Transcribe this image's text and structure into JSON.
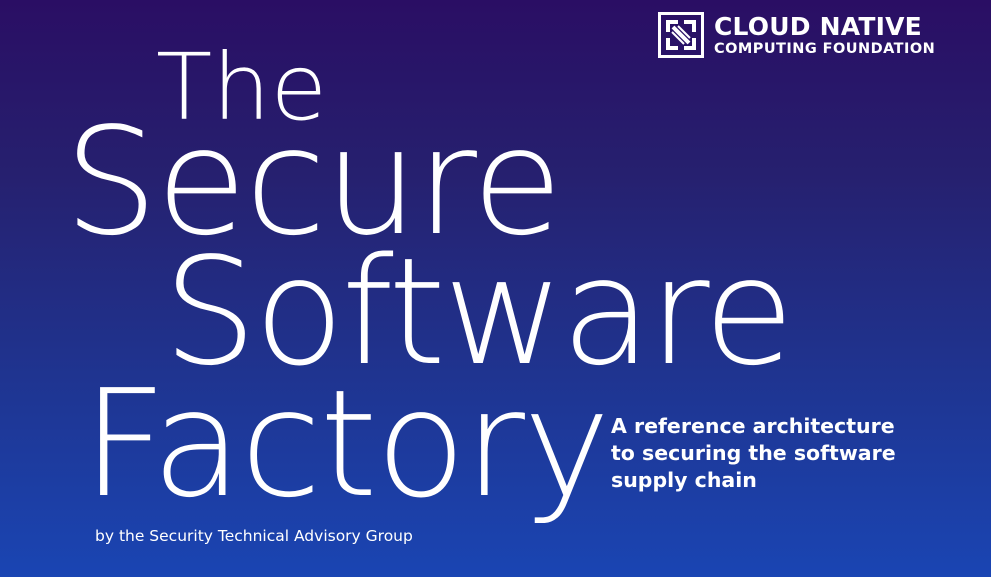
{
  "logo": {
    "icon": "cncf-logo-icon",
    "line1": "CLOUD NATIVE",
    "line2": "COMPUTING FOUNDATION"
  },
  "title": {
    "line1": "The",
    "line2": "Secure",
    "line3": "Software",
    "line4": "Factory"
  },
  "subtitle": {
    "line1": "A reference architecture",
    "line2": "to securing the software",
    "line3": "supply chain"
  },
  "byline": "by the Security Technical Advisory Group",
  "colors": {
    "background_top": "#2a0e64",
    "background_bottom": "#1a45b3",
    "text": "#ffffff"
  }
}
